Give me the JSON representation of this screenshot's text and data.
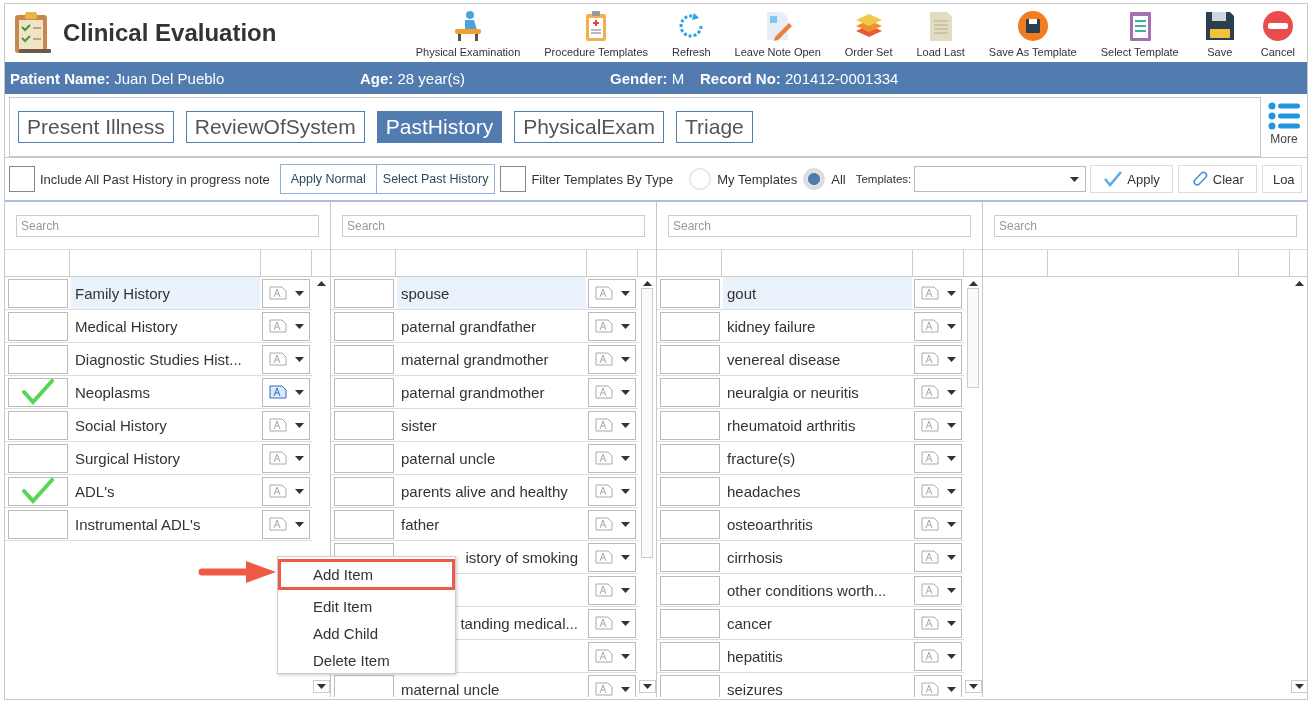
{
  "window": {
    "title": "Clinical Evaluation"
  },
  "toolbar": [
    {
      "label": "Physical Examination"
    },
    {
      "label": "Procedure Templates"
    },
    {
      "label": "Refresh"
    },
    {
      "label": "Leave Note Open"
    },
    {
      "label": "Order Set"
    },
    {
      "label": "Load Last"
    },
    {
      "label": "Save As Template"
    },
    {
      "label": "Select Template"
    },
    {
      "label": "Save"
    },
    {
      "label": "Cancel"
    }
  ],
  "patient": [
    {
      "label": "Patient Name:",
      "value": "Juan Del Pueblo"
    },
    {
      "label": "Age:",
      "value": "28 year(s)"
    },
    {
      "label": "Gender:",
      "value": "M"
    },
    {
      "label": "Record No:",
      "value": "201412-0001334"
    }
  ],
  "tabs": [
    {
      "label": "Present Illness",
      "selected": false
    },
    {
      "label": "ReviewOfSystem",
      "selected": false
    },
    {
      "label": "PastHistory",
      "selected": true
    },
    {
      "label": "PhysicalExam",
      "selected": false
    },
    {
      "label": "Triage",
      "selected": false
    }
  ],
  "more": {
    "label": "More"
  },
  "options": {
    "include_all": {
      "label": "Include All Past History in progress note",
      "checked": false
    },
    "apply_normal": "Apply Normal",
    "select_past_history": "Select Past History",
    "filter_by_type": {
      "label": "Filter Templates By Type",
      "checked": false
    },
    "radios": [
      {
        "label": "My Templates",
        "selected": false
      },
      {
        "label": "All",
        "selected": true
      }
    ],
    "templates_label": "Templates:",
    "apply": "Apply",
    "clear": "Clear",
    "load": "Loa"
  },
  "columns": [
    {
      "search_placeholder": "Search",
      "rows": [
        {
          "text": "Family History",
          "checked": false,
          "selected": true,
          "has_note": false
        },
        {
          "text": "Medical History",
          "checked": false,
          "selected": false,
          "has_note": false
        },
        {
          "text": "Diagnostic Studies Hist...",
          "checked": false,
          "selected": false,
          "has_note": false
        },
        {
          "text": "Neoplasms",
          "checked": true,
          "selected": false,
          "has_note": true
        },
        {
          "text": "Social History",
          "checked": false,
          "selected": false,
          "has_note": false
        },
        {
          "text": "Surgical History",
          "checked": false,
          "selected": false,
          "has_note": false
        },
        {
          "text": "ADL's",
          "checked": true,
          "selected": false,
          "has_note": false
        },
        {
          "text": "Instrumental ADL's",
          "checked": false,
          "selected": false,
          "has_note": false
        }
      ]
    },
    {
      "search_placeholder": "Search",
      "rows": [
        {
          "text": "spouse",
          "checked": false,
          "selected": true,
          "has_note": false
        },
        {
          "text": "paternal grandfather",
          "checked": false,
          "selected": false,
          "has_note": false
        },
        {
          "text": "maternal grandmother",
          "checked": false,
          "selected": false,
          "has_note": false
        },
        {
          "text": "paternal grandmother",
          "checked": false,
          "selected": false,
          "has_note": false
        },
        {
          "text": "sister",
          "checked": false,
          "selected": false,
          "has_note": false
        },
        {
          "text": "paternal uncle",
          "checked": false,
          "selected": false,
          "has_note": false
        },
        {
          "text": "parents alive and healthy",
          "checked": false,
          "selected": false,
          "has_note": false
        },
        {
          "text": "father",
          "checked": false,
          "selected": false,
          "has_note": false
        },
        {
          "text": "istory of smoking",
          "covered": true,
          "selected": false,
          "has_note": false
        },
        {
          "selected": false,
          "has_note": false
        },
        {
          "text": "tanding medical...",
          "covered": true,
          "selected": false,
          "has_note": false
        },
        {
          "selected": false,
          "has_note": false
        },
        {
          "text": "maternal uncle",
          "checked": false,
          "selected": false,
          "has_note": false
        }
      ]
    },
    {
      "search_placeholder": "Search",
      "rows": [
        {
          "text": "gout",
          "checked": false,
          "selected": true,
          "has_note": false
        },
        {
          "text": "kidney failure",
          "checked": false,
          "selected": false,
          "has_note": false
        },
        {
          "text": "venereal disease",
          "checked": false,
          "selected": false,
          "has_note": false
        },
        {
          "text": "neuralgia or neuritis",
          "checked": false,
          "selected": false,
          "has_note": false
        },
        {
          "text": "rheumatoid arthritis",
          "checked": false,
          "selected": false,
          "has_note": false
        },
        {
          "text": "fracture(s)",
          "checked": false,
          "selected": false,
          "has_note": false
        },
        {
          "text": "headaches",
          "checked": false,
          "selected": false,
          "has_note": false
        },
        {
          "text": "osteoarthritis",
          "checked": false,
          "selected": false,
          "has_note": false
        },
        {
          "text": "cirrhosis",
          "checked": false,
          "selected": false,
          "has_note": false
        },
        {
          "text": "other conditions worth...",
          "checked": false,
          "selected": false,
          "has_note": false
        },
        {
          "text": "cancer",
          "checked": false,
          "selected": false,
          "has_note": false
        },
        {
          "text": "hepatitis",
          "checked": false,
          "selected": false,
          "has_note": false
        },
        {
          "text": "seizures",
          "checked": false,
          "selected": false,
          "has_note": false
        }
      ]
    },
    {
      "search_placeholder": "Search"
    }
  ],
  "context_menu": [
    {
      "label": "Add Item",
      "highlighted": true
    },
    {
      "label": "Edit Item",
      "highlighted": false
    },
    {
      "label": "Add Child",
      "highlighted": false
    },
    {
      "label": "Delete Item",
      "highlighted": false
    }
  ]
}
